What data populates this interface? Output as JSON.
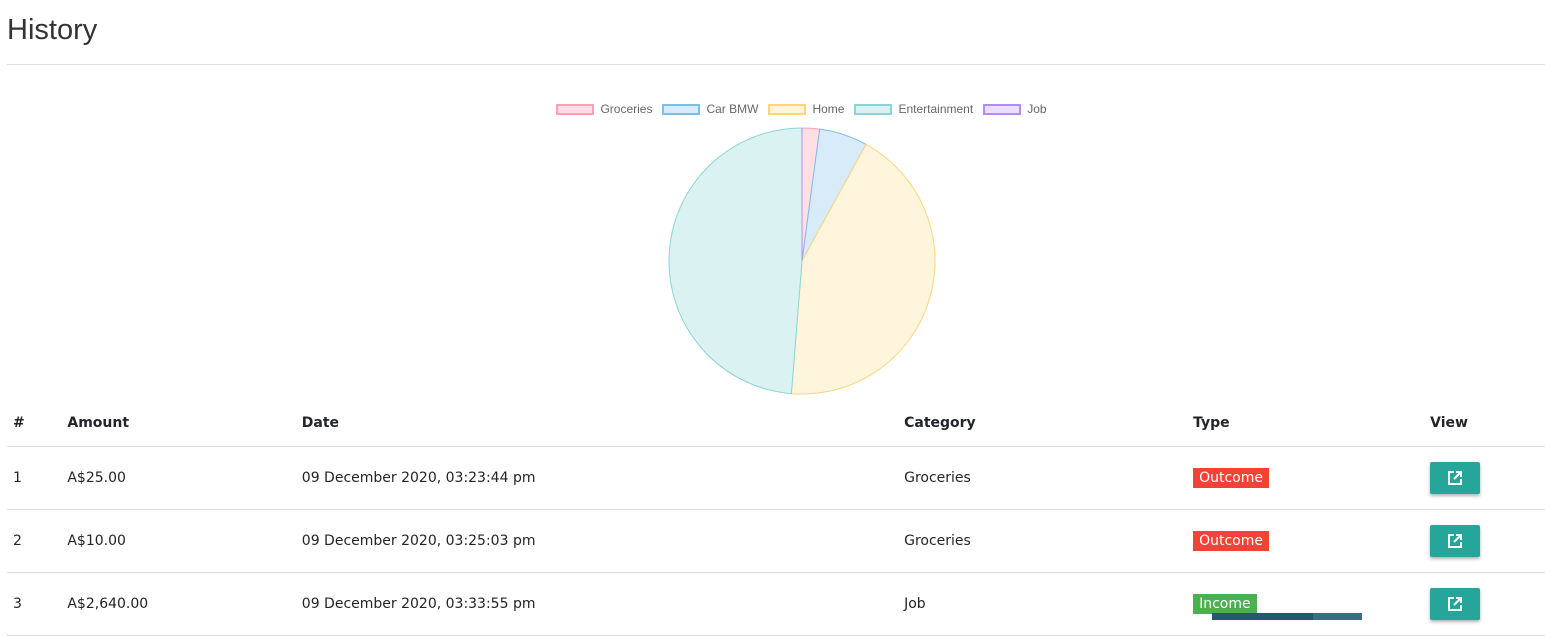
{
  "page_title": "History",
  "chart_data": {
    "type": "pie",
    "legend_position": "top",
    "categories": [
      "Groceries",
      "Car BMW",
      "Home",
      "Entertainment",
      "Job"
    ],
    "values": [
      35,
      97,
      714,
      804,
      0
    ],
    "colors": {
      "fill": [
        "#ffdfe5",
        "#d8ebf9",
        "#fff4dc",
        "#dbf2f2",
        "#ebe0ff"
      ],
      "border": [
        "#ff9fb3",
        "#7ebee9",
        "#ffd57f",
        "#8ad6d6",
        "#b28cff"
      ]
    }
  },
  "table": {
    "headers": [
      "#",
      "Amount",
      "Date",
      "Category",
      "Type",
      "View"
    ],
    "rows": [
      {
        "num": "1",
        "amount": "A$25.00",
        "date": "09 December 2020, 03:23:44 pm",
        "category": "Groceries",
        "type": "Outcome",
        "type_color": "#f44336"
      },
      {
        "num": "2",
        "amount": "A$10.00",
        "date": "09 December 2020, 03:25:03 pm",
        "category": "Groceries",
        "type": "Outcome",
        "type_color": "#f44336"
      },
      {
        "num": "3",
        "amount": "A$2,640.00",
        "date": "09 December 2020, 03:33:55 pm",
        "category": "Job",
        "type": "Income",
        "type_color": "#4caf50"
      }
    ]
  }
}
